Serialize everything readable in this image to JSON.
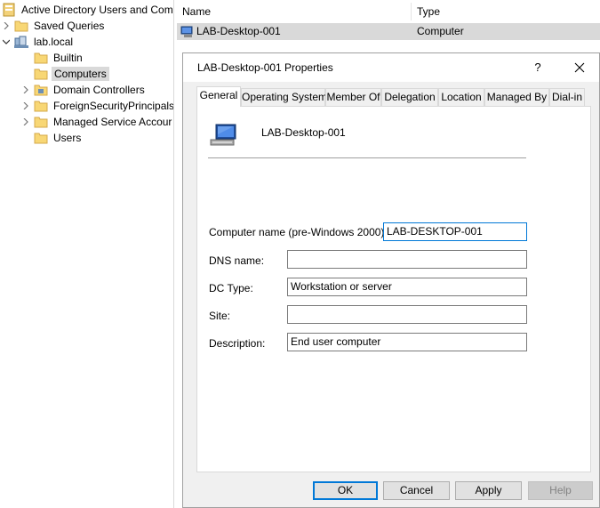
{
  "tree": {
    "root_label": "Active Directory Users and Com",
    "items": [
      {
        "label": "Saved Queries"
      },
      {
        "label": "lab.local"
      },
      {
        "label": "Builtin"
      },
      {
        "label": "Computers"
      },
      {
        "label": "Domain Controllers"
      },
      {
        "label": "ForeignSecurityPrincipals"
      },
      {
        "label": "Managed Service Accour"
      },
      {
        "label": "Users"
      }
    ]
  },
  "list": {
    "columns": [
      "Name",
      "Type"
    ],
    "rows": [
      {
        "name": "LAB-Desktop-001",
        "type": "Computer"
      }
    ]
  },
  "dialog": {
    "title": "LAB-Desktop-001 Properties",
    "help_glyph": "?",
    "tabs": [
      "General",
      "Operating System",
      "Member Of",
      "Delegation",
      "Location",
      "Managed By",
      "Dial-in"
    ],
    "active_tab": "General",
    "computer_name": "LAB-Desktop-001",
    "fields": {
      "computer_name_pre2000": {
        "label": "Computer name (pre-Windows 2000):",
        "value": "LAB-DESKTOP-001"
      },
      "dns_name": {
        "label": "DNS name:",
        "value": ""
      },
      "dc_type": {
        "label": "DC Type:",
        "value": "Workstation or server"
      },
      "site": {
        "label": "Site:",
        "value": ""
      },
      "description": {
        "label": "Description:",
        "value": "End user computer"
      }
    },
    "buttons": {
      "ok": "OK",
      "cancel": "Cancel",
      "apply": "Apply",
      "help": "Help"
    }
  },
  "colors": {
    "selection": "#cce8ff",
    "accent": "#0078d7",
    "folder": "#f8d775"
  }
}
